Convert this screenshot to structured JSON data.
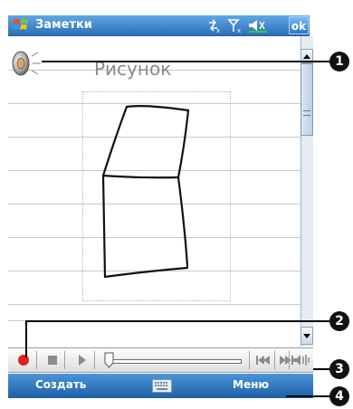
{
  "titlebar": {
    "app_title": "Заметки",
    "ok_label": "ok",
    "icons": [
      "windows-start-icon",
      "connectivity-icon",
      "signal-off-icon",
      "volume-muted-icon"
    ]
  },
  "note": {
    "drawing_label": "Рисунок",
    "icons": [
      "speaker-voice-note-icon"
    ]
  },
  "recording_toolbar": {
    "icons": [
      "record-icon",
      "stop-icon",
      "play-icon",
      "skip-back-icon",
      "skip-forward-icon",
      "volume-icon"
    ],
    "position": 0
  },
  "menubar": {
    "left_softkey": "Создать",
    "right_softkey": "Меню",
    "icons": [
      "keyboard-icon"
    ]
  },
  "callouts": [
    "1",
    "2",
    "3",
    "4"
  ],
  "colors": {
    "title_bar": "#2d6fb7",
    "menu_bar": "#1e5fa6",
    "record_red": "#e02020",
    "callout": "#111111"
  }
}
